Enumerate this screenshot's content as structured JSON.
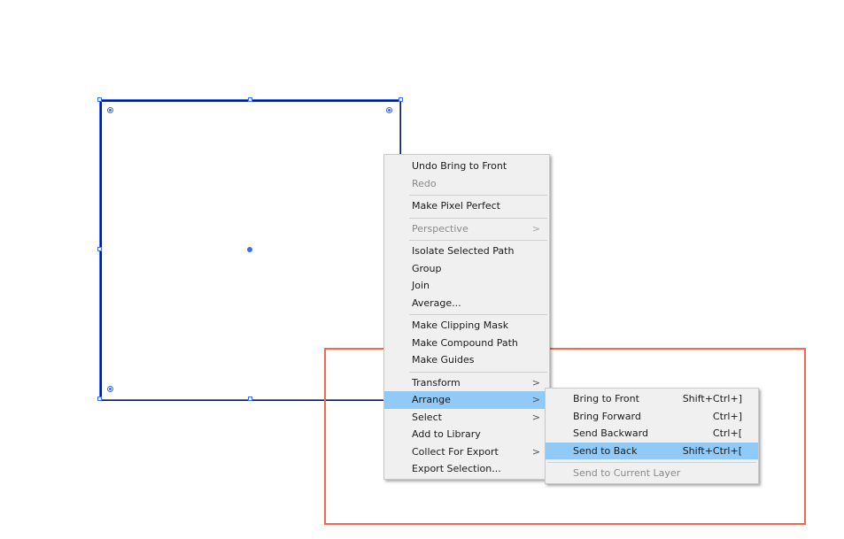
{
  "context_menu": {
    "undo": "Undo Bring to Front",
    "redo": "Redo",
    "make_pixel_perfect": "Make Pixel Perfect",
    "perspective": "Perspective",
    "isolate_selected_path": "Isolate Selected Path",
    "group": "Group",
    "join": "Join",
    "average": "Average...",
    "make_clipping_mask": "Make Clipping Mask",
    "make_compound_path": "Make Compound Path",
    "make_guides": "Make Guides",
    "transform": "Transform",
    "arrange": "Arrange",
    "select": "Select",
    "add_to_library": "Add to Library",
    "collect_for_export": "Collect For Export",
    "export_selection": "Export Selection..."
  },
  "arrange_submenu": {
    "bring_to_front": {
      "label": "Bring to Front",
      "shortcut": "Shift+Ctrl+]"
    },
    "bring_forward": {
      "label": "Bring Forward",
      "shortcut": "Ctrl+]"
    },
    "send_backward": {
      "label": "Send Backward",
      "shortcut": "Ctrl+["
    },
    "send_to_back": {
      "label": "Send to Back",
      "shortcut": "Shift+Ctrl+["
    },
    "send_to_current_layer": {
      "label": "Send to Current Layer"
    }
  },
  "icons": {
    "submenu_arrow": "chevron-right-icon"
  },
  "colors": {
    "highlight_item": "#91c9f7",
    "selection": "#3a6cf0",
    "shape_stroke": "#0b1a4f",
    "annotation_box": "#ef6a4f"
  }
}
